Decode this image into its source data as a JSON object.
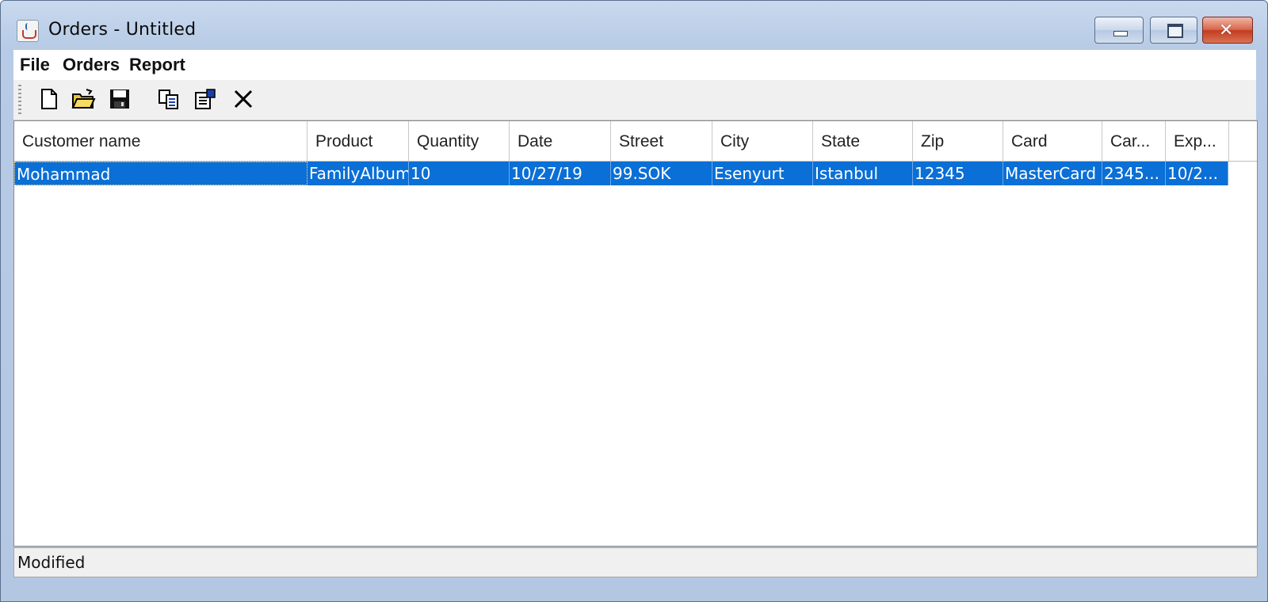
{
  "window": {
    "title": "Orders - Untitled"
  },
  "menu": {
    "items": [
      "File",
      "Orders",
      "Report"
    ]
  },
  "toolbar": {
    "buttons": [
      "new-document-icon",
      "open-folder-icon",
      "save-disk-icon",
      "copy-icon",
      "properties-icon",
      "delete-x-icon"
    ]
  },
  "table": {
    "columns": [
      "Customer name",
      "Product",
      "Quantity",
      "Date",
      "Street",
      "City",
      "State",
      "Zip",
      "Card",
      "Car...",
      "Exp..."
    ],
    "rows": [
      [
        "Mohammad",
        "FamilyAlbum",
        "10",
        "10/27/19",
        "99.SOK",
        "Esenyurt",
        "Istanbul",
        "12345",
        "MasterCard",
        "2345...",
        "10/2..."
      ]
    ],
    "selected_row": 0
  },
  "status": {
    "text": "Modified"
  },
  "colors": {
    "selection": "#0a6fd6",
    "frame": "#b7cbe6",
    "close": "#c13c20"
  }
}
